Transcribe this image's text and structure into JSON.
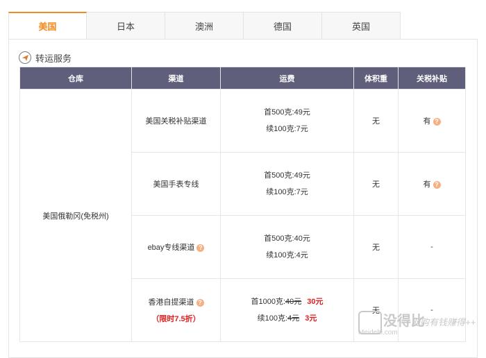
{
  "tabs": [
    "美国",
    "日本",
    "澳洲",
    "德国",
    "英国"
  ],
  "section": {
    "title": "转运服务",
    "icon": "paper-plane-icon"
  },
  "table": {
    "headers": [
      "仓库",
      "渠道",
      "运费",
      "体积重",
      "关税补贴"
    ],
    "warehouse": "美国俄勒冈(免税州)",
    "rows": [
      {
        "channel": "美国关税补贴渠道",
        "fee_line1": "首500克:49元",
        "fee_line2": "续100克:7元",
        "volume": "无",
        "tax": "有"
      },
      {
        "channel": "美国手表专线",
        "fee_line1": "首500克:49元",
        "fee_line2": "续100克:7元",
        "volume": "无",
        "tax": "有"
      },
      {
        "channel": "ebay专线渠道",
        "fee_line1": "首500克:40元",
        "fee_line2": "续100克:4元",
        "volume": "无",
        "tax": "-"
      },
      {
        "channel": "香港自提渠道",
        "discount": "（限时7.5折）",
        "fee1_prefix": "首1000克:",
        "fee1_old": "40元",
        "fee1_new": "30元",
        "fee2_prefix": "续100克:",
        "fee2_old": "4元",
        "fee2_new": "3元",
        "volume": "无",
        "tax": "-"
      }
    ]
  },
  "watermark": {
    "brand": "没得比",
    "domain": "Meidebi.com",
    "slogan": "网购有钱赚得++"
  },
  "colors": {
    "accent": "#f28b1d",
    "table_header": "#5f5f7b",
    "sale_red": "#e02020",
    "help_icon": "#f5b080"
  }
}
